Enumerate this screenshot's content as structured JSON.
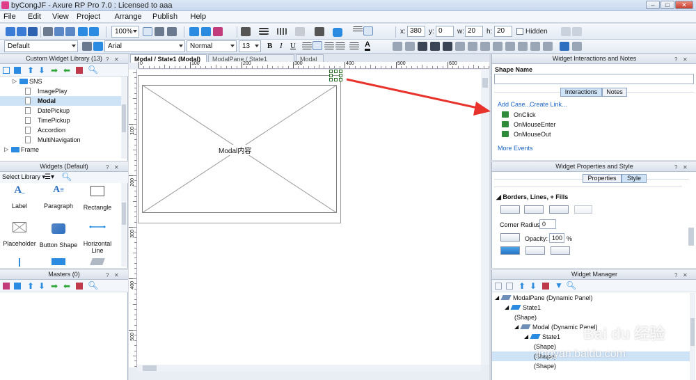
{
  "window": {
    "title": "byCongJF - Axure RP Pro 7.0 : Licensed to aaa",
    "minimize": "–",
    "maximize": "□",
    "close": "✕"
  },
  "menu": [
    "File",
    "Edit",
    "View",
    "Project",
    "Arrange",
    "Publish",
    "Help"
  ],
  "toolbar1": {
    "zoom": "100%",
    "x_label": "x:",
    "x_value": "380",
    "y_label": "y:",
    "y_value": "0",
    "w_label": "w:",
    "w_value": "20",
    "h_label": "h:",
    "h_value": "20",
    "hidden_label": "Hidden"
  },
  "toolbar2": {
    "style_select": "Default",
    "font_select": "Arial",
    "weight_select": "Normal",
    "size_select": "13",
    "bold": "B",
    "italic": "I",
    "underline": "U",
    "font_color": "A"
  },
  "left": {
    "library_panel": {
      "title": "Custom Widget Library (13)",
      "items": [
        {
          "label": "SNS",
          "type": "folder",
          "indent": 1
        },
        {
          "label": "ImagePlay",
          "type": "file",
          "indent": 2
        },
        {
          "label": "Modal",
          "type": "file",
          "indent": 2,
          "selected": true
        },
        {
          "label": "DatePickup",
          "type": "file",
          "indent": 2
        },
        {
          "label": "TimePickup",
          "type": "file",
          "indent": 2
        },
        {
          "label": "Accordion",
          "type": "file",
          "indent": 2
        },
        {
          "label": "MultiNavigation",
          "type": "file",
          "indent": 2
        },
        {
          "label": "Frame",
          "type": "folder",
          "indent": 0
        }
      ]
    },
    "widgets_panel": {
      "title": "Widgets (Default)",
      "select_library": "Select Library",
      "widgets": [
        {
          "label": "Label"
        },
        {
          "label": "Paragraph"
        },
        {
          "label": "Rectangle"
        },
        {
          "label": "Placeholder"
        },
        {
          "label": "Button Shape"
        },
        {
          "label": "Horizontal Line"
        }
      ]
    },
    "masters_panel": {
      "title": "Masters (0)"
    }
  },
  "tabs": [
    {
      "label": "Modal / State1 (Modal)",
      "active": true
    },
    {
      "label": "ModalPane / State1 (Modal)",
      "active": false
    },
    {
      "label": "Modal",
      "active": false
    }
  ],
  "ruler": {
    "h_ticks": [
      "0",
      "100",
      "200",
      "300",
      "400",
      "500",
      "600"
    ],
    "v_ticks": [
      "100",
      "200",
      "300",
      "400",
      "500"
    ]
  },
  "canvas": {
    "placeholder_text": "Modal内容"
  },
  "right": {
    "interactions_panel": {
      "title": "Widget Interactions and Notes",
      "shape_name_label": "Shape Name",
      "shape_name_value": "",
      "tab_interactions": "Interactions",
      "tab_notes": "Notes",
      "add_case": "Add Case...",
      "create_link": "Create Link...",
      "events": [
        "OnClick",
        "OnMouseEnter",
        "OnMouseOut"
      ],
      "more_events": "More Events"
    },
    "properties_panel": {
      "title": "Widget Properties and Style",
      "tab_properties": "Properties",
      "tab_style": "Style",
      "section": "Borders, Lines, + Fills",
      "corner_radius_label": "Corner Radius:",
      "corner_radius_value": "0",
      "opacity_label": "Opacity:",
      "opacity_value": "100",
      "opacity_unit": "%"
    },
    "manager_panel": {
      "title": "Widget Manager",
      "tree": [
        {
          "label": "ModalPane (Dynamic Panel)",
          "indent": 0,
          "icon": "panel"
        },
        {
          "label": "State1",
          "indent": 1,
          "icon": "state"
        },
        {
          "label": "(Shape)",
          "indent": 2,
          "icon": "none"
        },
        {
          "label": "Modal (Dynamic Panel)",
          "indent": 2,
          "icon": "panel"
        },
        {
          "label": "State1",
          "indent": 3,
          "icon": "state"
        },
        {
          "label": "(Shape)",
          "indent": 4,
          "icon": "none"
        },
        {
          "label": "(Shape)",
          "indent": 4,
          "icon": "none",
          "selected": true
        },
        {
          "label": "(Shape)",
          "indent": 4,
          "icon": "none"
        }
      ]
    }
  },
  "watermark": {
    "text": "Bai du 经验",
    "url": "jingyan.baidu.com"
  },
  "colors": {
    "accent": "#2b8be0",
    "event_green": "#2e8b3a",
    "arrow_red": "#e8332c",
    "selection": "#cfe3f7"
  }
}
